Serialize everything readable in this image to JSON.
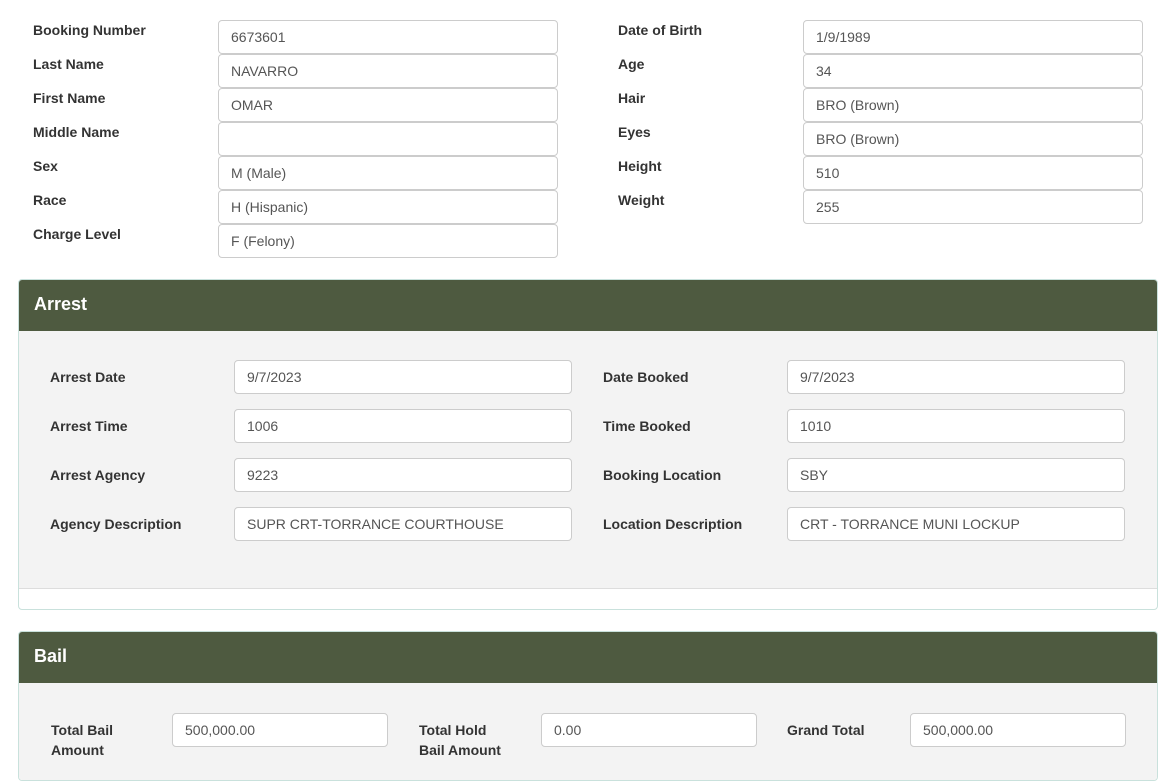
{
  "inmate": {
    "left": [
      {
        "label": "Booking Number",
        "value": "6673601"
      },
      {
        "label": "Last Name",
        "value": "NAVARRO"
      },
      {
        "label": "First Name",
        "value": "OMAR"
      },
      {
        "label": "Middle Name",
        "value": ""
      },
      {
        "label": "Sex",
        "value": "M (Male)"
      },
      {
        "label": "Race",
        "value": "H (Hispanic)"
      },
      {
        "label": "Charge Level",
        "value": "F (Felony)"
      }
    ],
    "right": [
      {
        "label": "Date of Birth",
        "value": "1/9/1989"
      },
      {
        "label": "Age",
        "value": "34"
      },
      {
        "label": "Hair",
        "value": "BRO (Brown)"
      },
      {
        "label": "Eyes",
        "value": "BRO (Brown)"
      },
      {
        "label": "Height",
        "value": "510"
      },
      {
        "label": "Weight",
        "value": "255"
      }
    ]
  },
  "arrest": {
    "title": "Arrest",
    "left": [
      {
        "label": "Arrest Date",
        "value": "9/7/2023"
      },
      {
        "label": "Arrest Time",
        "value": "1006"
      },
      {
        "label": "Arrest Agency",
        "value": "9223"
      },
      {
        "label": "Agency Description",
        "value": "SUPR CRT-TORRANCE COURTHOUSE"
      }
    ],
    "right": [
      {
        "label": "Date Booked",
        "value": "9/7/2023"
      },
      {
        "label": "Time Booked",
        "value": "1010"
      },
      {
        "label": "Booking Location",
        "value": "SBY"
      },
      {
        "label": "Location Description",
        "value": "CRT - TORRANCE MUNI LOCKUP"
      }
    ]
  },
  "bail": {
    "title": "Bail",
    "total_bail": {
      "label_line1": "Total Bail",
      "label_line2": "Amount",
      "value": "500,000.00"
    },
    "total_hold": {
      "label_line1": "Total Hold",
      "label_line2": "Bail Amount",
      "value": "0.00"
    },
    "grand_total": {
      "label": "Grand Total",
      "value": "500,000.00"
    }
  }
}
